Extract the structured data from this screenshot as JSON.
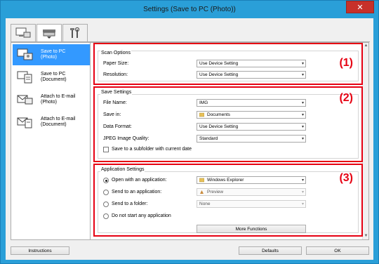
{
  "window": {
    "title": "Settings (Save to PC (Photo))",
    "close_glyph": "✕"
  },
  "tabs": [
    {
      "name": "scan-from-computer-tab",
      "icon": "monitor-scanner-icon"
    },
    {
      "name": "scan-from-operation-panel-tab",
      "icon": "scanner-icon"
    },
    {
      "name": "general-settings-tab",
      "icon": "tools-icon"
    }
  ],
  "sidebar": {
    "items": [
      {
        "label": "Save to PC\n(Photo)",
        "icon": "save-photo-icon",
        "selected": true
      },
      {
        "label": "Save to PC\n(Document)",
        "icon": "save-document-icon",
        "selected": false
      },
      {
        "label": "Attach to E-mail\n(Photo)",
        "icon": "email-photo-icon",
        "selected": false
      },
      {
        "label": "Attach to E-mail\n(Document)",
        "icon": "email-document-icon",
        "selected": false
      }
    ]
  },
  "scan_options": {
    "title": "Scan Options",
    "number": "(1)",
    "paper_size_label": "Paper Size:",
    "paper_size_value": "Use Device Setting",
    "resolution_label": "Resolution:",
    "resolution_value": "Use Device Setting"
  },
  "save_settings": {
    "title": "Save Settings",
    "number": "(2)",
    "file_name_label": "File Name:",
    "file_name_value": "IMG",
    "save_in_label": "Save in:",
    "save_in_value": "Documents",
    "data_format_label": "Data Format:",
    "data_format_value": "Use Device Setting",
    "jpeg_quality_label": "JPEG Image Quality:",
    "jpeg_quality_value": "Standard",
    "subfolder_label": "Save to a subfolder with current date"
  },
  "application_settings": {
    "title": "Application Settings",
    "number": "(3)",
    "open_with_label": "Open with an application:",
    "open_with_value": "Windows Explorer",
    "send_to_app_label": "Send to an application:",
    "send_to_app_value": "Preview",
    "send_to_folder_label": "Send to a folder:",
    "send_to_folder_value": "None",
    "do_not_start_label": "Do not start any application",
    "more_functions_label": "More Functions"
  },
  "footer": {
    "instructions_label": "Instructions",
    "defaults_label": "Defaults",
    "ok_label": "OK"
  },
  "colors": {
    "accent_red": "#e60012",
    "selection_blue": "#3399ff",
    "window_blue": "#2a9fd8"
  }
}
